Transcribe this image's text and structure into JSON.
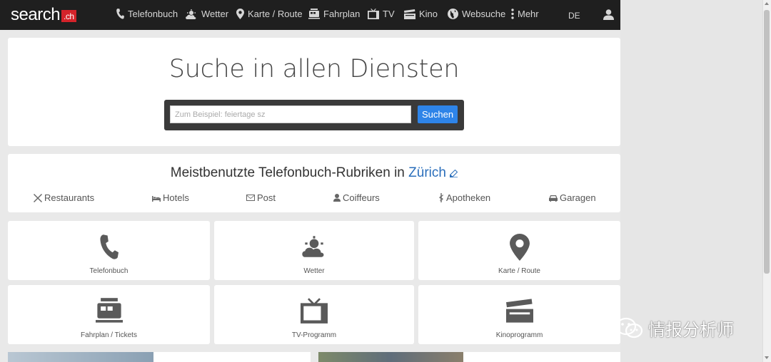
{
  "navbar": {
    "logo_text": "search",
    "logo_badge": ".ch",
    "items": [
      {
        "label": "Telefonbuch",
        "icon": "phone-icon"
      },
      {
        "label": "Wetter",
        "icon": "weather-icon"
      },
      {
        "label": "Karte / Route",
        "icon": "map-pin-icon"
      },
      {
        "label": "Fahrplan",
        "icon": "train-icon"
      },
      {
        "label": "TV",
        "icon": "tv-icon"
      },
      {
        "label": "Kino",
        "icon": "clapper-icon"
      },
      {
        "label": "Websuche",
        "icon": "globe-icon"
      },
      {
        "label": "Mehr",
        "icon": "more-icon"
      }
    ],
    "language": "DE",
    "user_icon": "user-icon"
  },
  "hero": {
    "title": "Suche in allen Diensten",
    "search_placeholder": "Zum Beispiel: feiertage sz",
    "search_button": "Suchen"
  },
  "rubriken": {
    "title_prefix": "Meistbenutzte Telefonbuch-Rubriken in ",
    "city": "Zürich",
    "items": [
      {
        "label": "Restaurants",
        "icon": "cutlery-icon"
      },
      {
        "label": "Hotels",
        "icon": "bed-icon"
      },
      {
        "label": "Post",
        "icon": "envelope-icon"
      },
      {
        "label": "Coiffeurs",
        "icon": "person-icon"
      },
      {
        "label": "Apotheken",
        "icon": "pharmacy-icon"
      },
      {
        "label": "Garagen",
        "icon": "car-icon"
      }
    ]
  },
  "tiles": [
    {
      "label": "Telefonbuch",
      "icon": "phone-icon"
    },
    {
      "label": "Wetter",
      "icon": "weather-icon"
    },
    {
      "label": "Karte / Route",
      "icon": "map-pin-icon"
    },
    {
      "label": "Fahrplan / Tickets",
      "icon": "train-icon"
    },
    {
      "label": "TV-Programm",
      "icon": "tv-icon"
    },
    {
      "label": "Kinoprogramm",
      "icon": "clapper-icon"
    }
  ],
  "watermark": "情报分析师",
  "colors": {
    "navbar_bg": "#1f1f1f",
    "accent_blue": "#2e84e8",
    "city_link": "#2a6ebb",
    "logo_red": "#d4232a"
  }
}
